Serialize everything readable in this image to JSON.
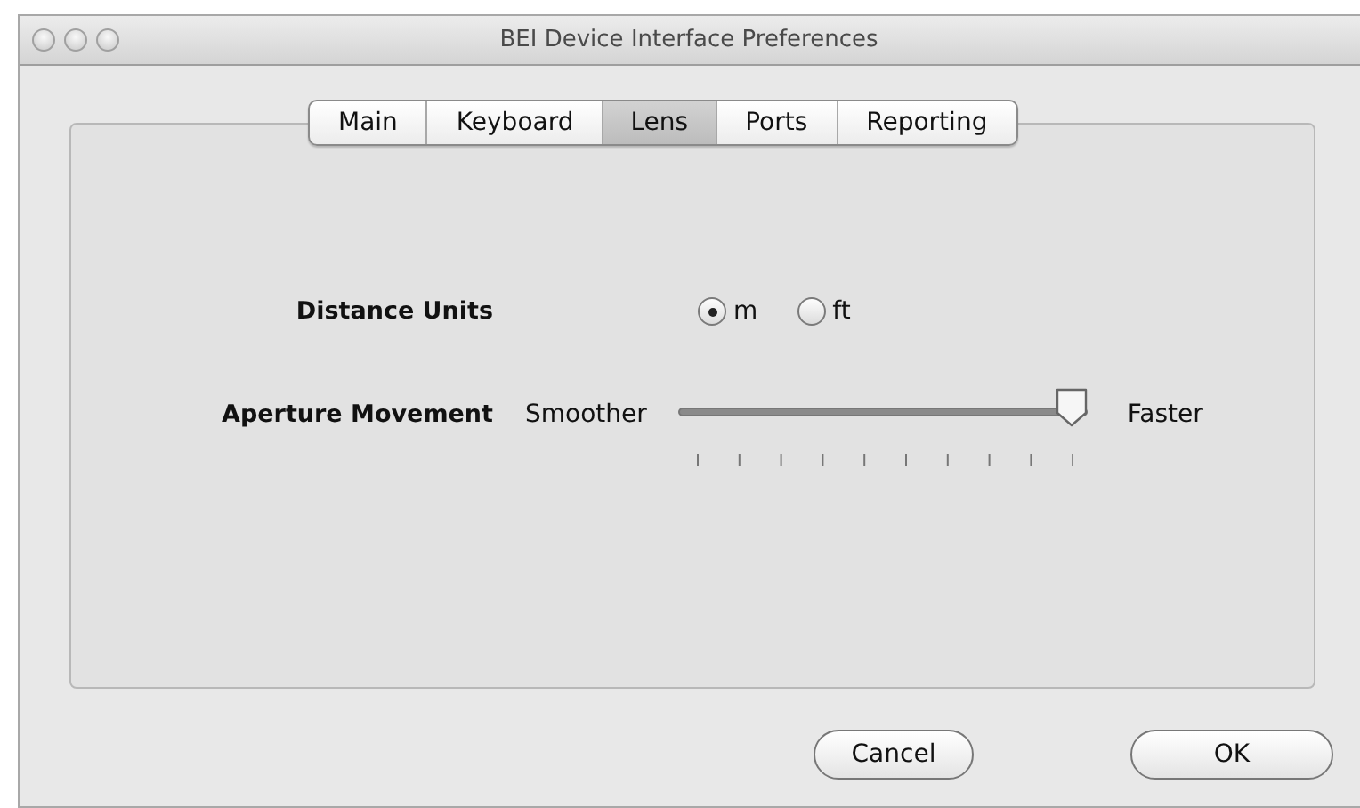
{
  "window": {
    "title": "BEI Device Interface Preferences"
  },
  "tabs": [
    {
      "label": "Main",
      "selected": false
    },
    {
      "label": "Keyboard",
      "selected": false
    },
    {
      "label": "Lens",
      "selected": true
    },
    {
      "label": "Ports",
      "selected": false
    },
    {
      "label": "Reporting",
      "selected": false
    }
  ],
  "distance_units": {
    "label": "Distance Units",
    "options": [
      {
        "label": "m",
        "selected": true
      },
      {
        "label": "ft",
        "selected": false
      }
    ]
  },
  "aperture_movement": {
    "label": "Aperture Movement",
    "min_label": "Smoother",
    "max_label": "Faster",
    "level": 1.0
  },
  "buttons": [
    "Cancel",
    "OK"
  ]
}
